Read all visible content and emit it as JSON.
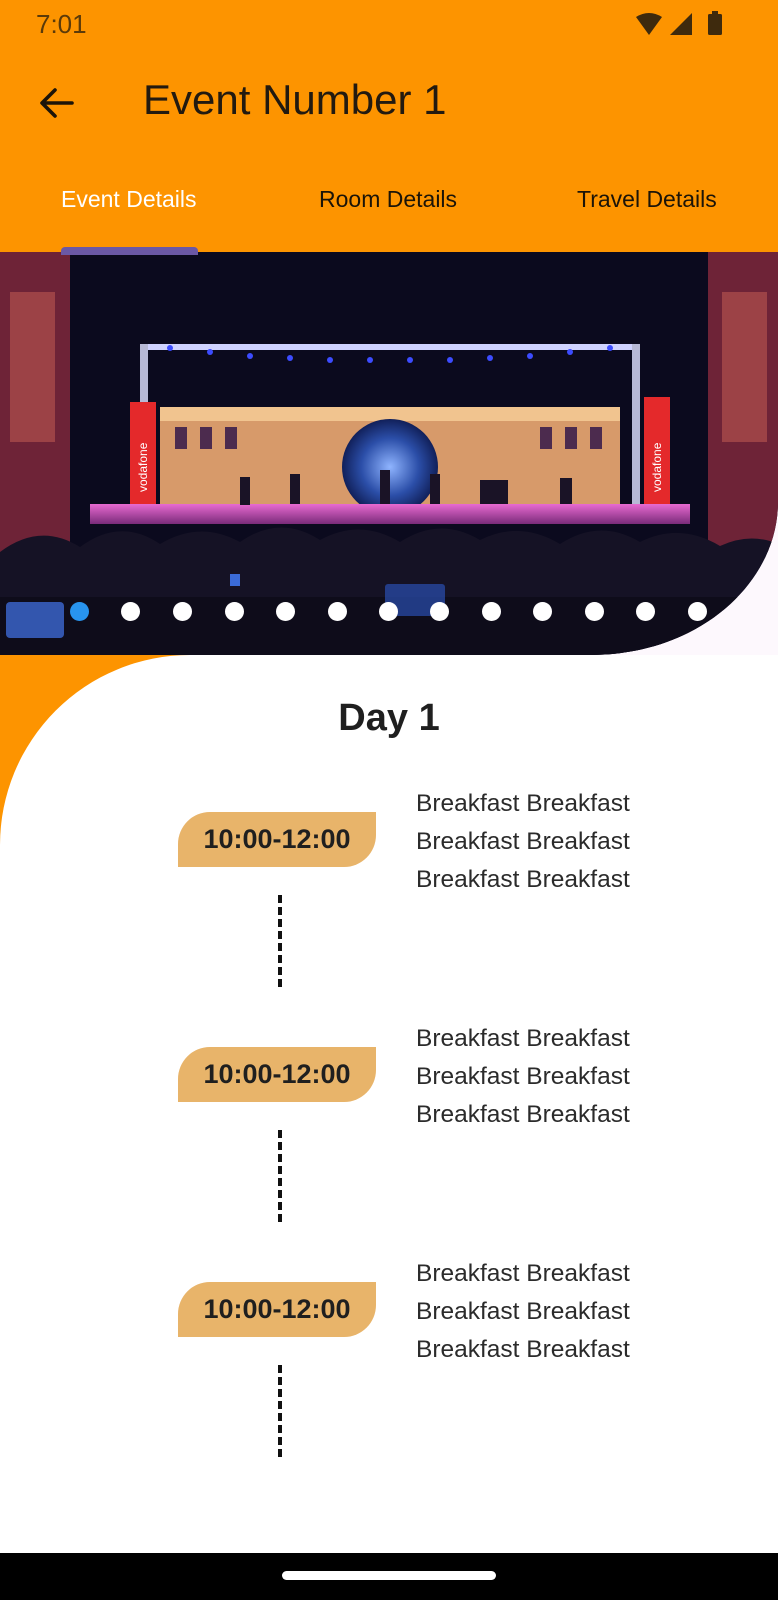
{
  "status_bar": {
    "time": "7:01"
  },
  "app_bar": {
    "title": "Event Number 1"
  },
  "tabs": [
    {
      "label": "Event Details",
      "active": true
    },
    {
      "label": "Room Details",
      "active": false
    },
    {
      "label": "Travel Details",
      "active": false
    }
  ],
  "carousel": {
    "slide_count": 13,
    "active_index": 0,
    "banner_text": "vodafone"
  },
  "schedule": {
    "day_title": "Day 1",
    "slots": [
      {
        "time": "10:00-12:00",
        "lines": [
          "Breakfast Breakfast",
          "Breakfast Breakfast",
          "Breakfast Breakfast"
        ]
      },
      {
        "time": "10:00-12:00",
        "lines": [
          "Breakfast Breakfast",
          "Breakfast Breakfast",
          "Breakfast Breakfast"
        ]
      },
      {
        "time": "10:00-12:00",
        "lines": [
          "Breakfast Breakfast",
          "Breakfast Breakfast",
          "Breakfast Breakfast"
        ]
      }
    ]
  },
  "colors": {
    "primary": "#fd9400",
    "active_tab_text": "#ffffff",
    "tab_indicator": "#6b58a5",
    "time_pill": "#e8b46a",
    "active_dot": "#2894ee"
  }
}
